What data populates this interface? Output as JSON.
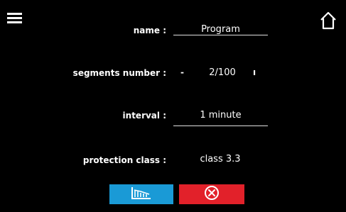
{
  "icons": {
    "menu": "menu-icon",
    "home": "home-icon",
    "graph": "graph-icon",
    "cancel": "cancel-icon"
  },
  "form": {
    "name": {
      "label": "name :",
      "value": "Program"
    },
    "segments_number": {
      "label": "segments number :",
      "value": "2/100",
      "decrement": "-",
      "increment": "ı"
    },
    "interval": {
      "label": "interval :",
      "value": "1 minute"
    },
    "protection_class": {
      "label": "protection class :",
      "value": "class 3.3"
    }
  },
  "colors": {
    "background": "#000000",
    "graph_button": "#1a9ad6",
    "cancel_button": "#e2212a"
  }
}
